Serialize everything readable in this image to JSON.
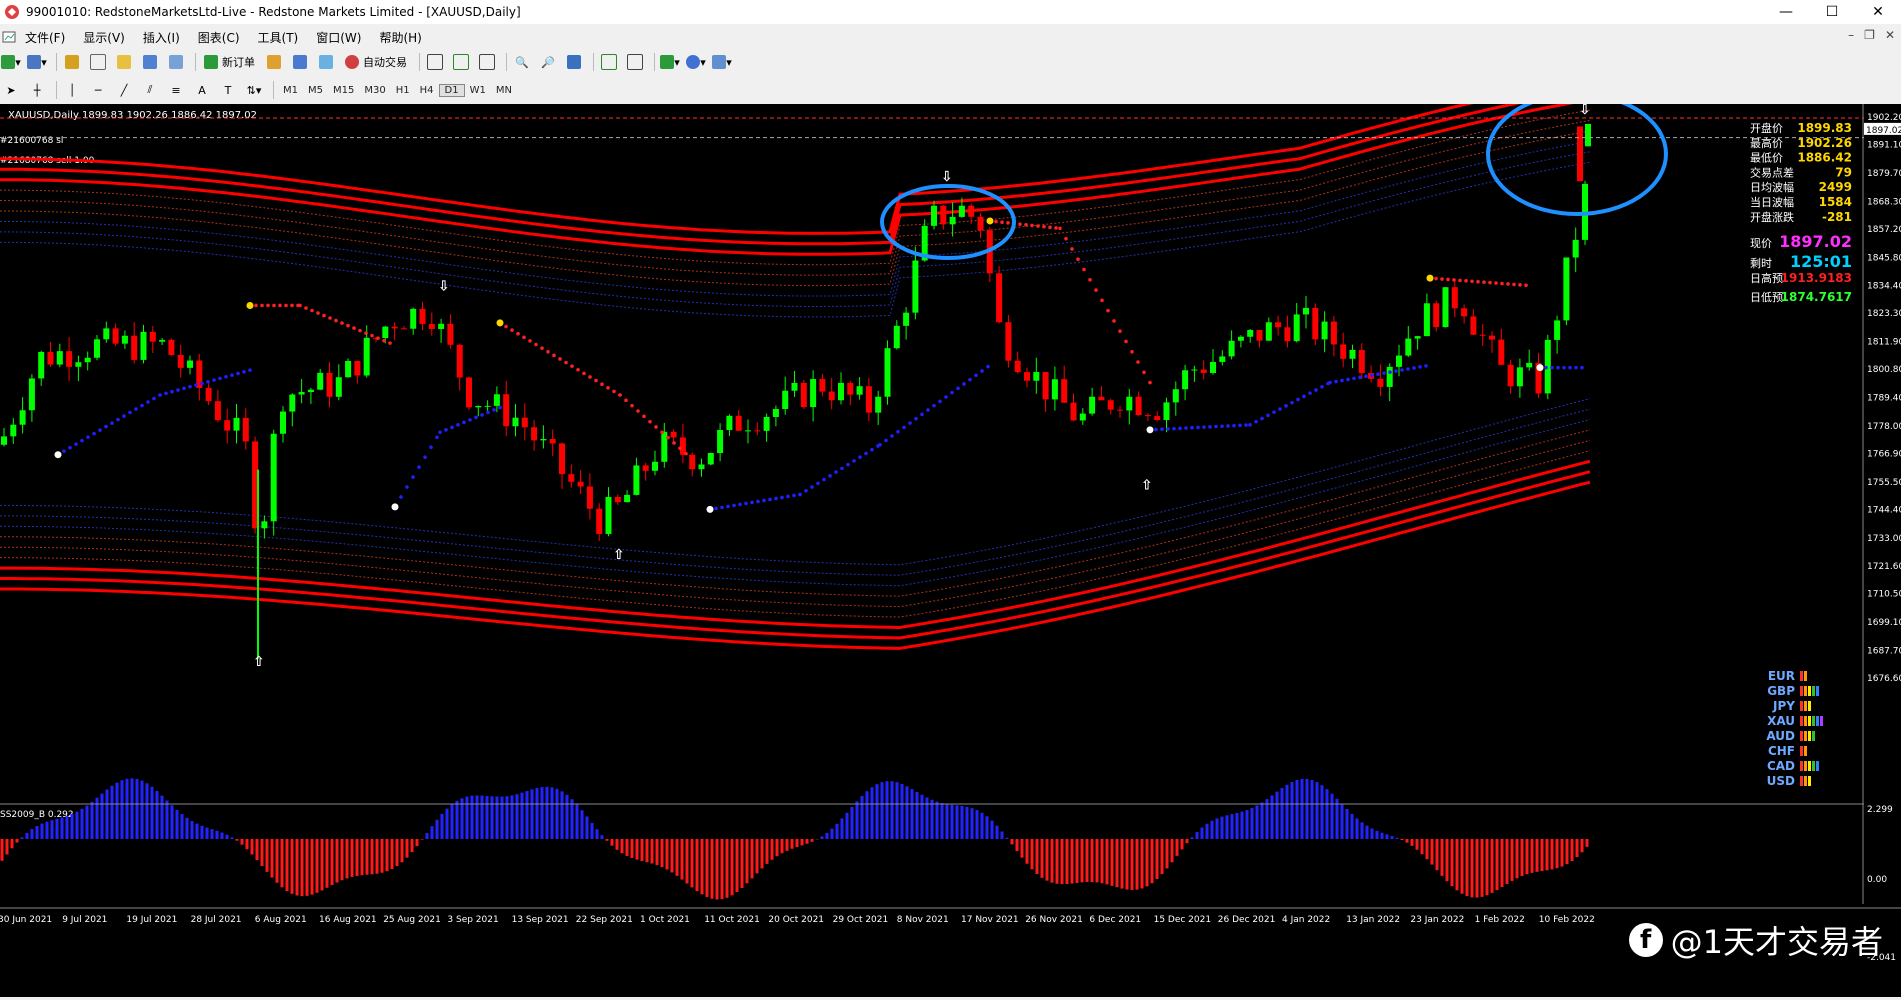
{
  "window": {
    "title": "99001010: RedstoneMarketsLtd-Live - Redstone Markets Limited - [XAUUSD,Daily]",
    "minimize": "—",
    "maximize": "☐",
    "close": "✕"
  },
  "menu": [
    "文件(F)",
    "显示(V)",
    "插入(I)",
    "图表(C)",
    "工具(T)",
    "窗口(W)",
    "帮助(H)"
  ],
  "toolbar": {
    "new_order": "新订单",
    "auto_trade": "自动交易",
    "timeframes": [
      "M1",
      "M5",
      "M15",
      "M30",
      "H1",
      "H4",
      "D1",
      "W1",
      "MN"
    ]
  },
  "chart": {
    "header": "XAUUSD,Daily  1899.83 1902.26 1886.42 1897.02",
    "order_line_1": "#21600768 sl",
    "order_line_2": "#21680768 sell 1.00",
    "indicator_label": "SS2009_B 0.292",
    "price_axis": [
      "1902.20",
      "1891.10",
      "1879.70",
      "1868.30",
      "1857.20",
      "1845.80",
      "1834.40",
      "1823.30",
      "1811.90",
      "1800.80",
      "1789.40",
      "1778.00",
      "1766.90",
      "1755.50",
      "1744.40",
      "1733.00",
      "1721.60",
      "1710.50",
      "1699.10",
      "1687.70",
      "1676.60"
    ],
    "current_price_tag": "1897.02",
    "indicator_axis": [
      "2.299",
      "0.00",
      "-2.041"
    ],
    "date_axis": [
      "30 Jun 2021",
      "9 Jul 2021",
      "19 Jul 2021",
      "28 Jul 2021",
      "6 Aug 2021",
      "16 Aug 2021",
      "25 Aug 2021",
      "3 Sep 2021",
      "13 Sep 2021",
      "22 Sep 2021",
      "1 Oct 2021",
      "11 Oct 2021",
      "20 Oct 2021",
      "29 Oct 2021",
      "8 Nov 2021",
      "17 Nov 2021",
      "26 Nov 2021",
      "6 Dec 2021",
      "15 Dec 2021",
      "26 Dec 2021",
      "4 Jan 2022",
      "13 Jan 2022",
      "23 Jan 2022",
      "1 Feb 2022",
      "10 Feb 2022"
    ]
  },
  "info_panel": [
    {
      "label": "开盘价",
      "value": "1899.83",
      "color": "#ffd700"
    },
    {
      "label": "最高价",
      "value": "1902.26",
      "color": "#ffd700"
    },
    {
      "label": "最低价",
      "value": "1886.42",
      "color": "#ffd700"
    },
    {
      "label": "交易点差",
      "value": "79",
      "color": "#ffd700"
    },
    {
      "label": "日均波幅",
      "value": "2499",
      "color": "#ffd700"
    },
    {
      "label": "当日波幅",
      "value": "1584",
      "color": "#ffd700"
    },
    {
      "label": "开盘涨跌",
      "value": "-281",
      "color": "#ffd700"
    }
  ],
  "price_now": {
    "label": "现价",
    "value": "1897.02"
  },
  "time_left": {
    "label": "剩时",
    "value": "125:01"
  },
  "daily_high_est": {
    "label": "日高预",
    "value": "1913.9183"
  },
  "daily_low_est": {
    "label": "日低预",
    "value": "1874.7617"
  },
  "currencies": [
    "EUR",
    "GBP",
    "JPY",
    "XAU",
    "AUD",
    "CHF",
    "CAD",
    "USD"
  ],
  "watermark": "@1天才交易者",
  "colors": {
    "bull": "#00ff00",
    "bear": "#ff0000",
    "band": "#ff0000",
    "trail_red": "#ff2020",
    "trail_blue": "#2020ff",
    "circle": "#1e90ff"
  }
}
